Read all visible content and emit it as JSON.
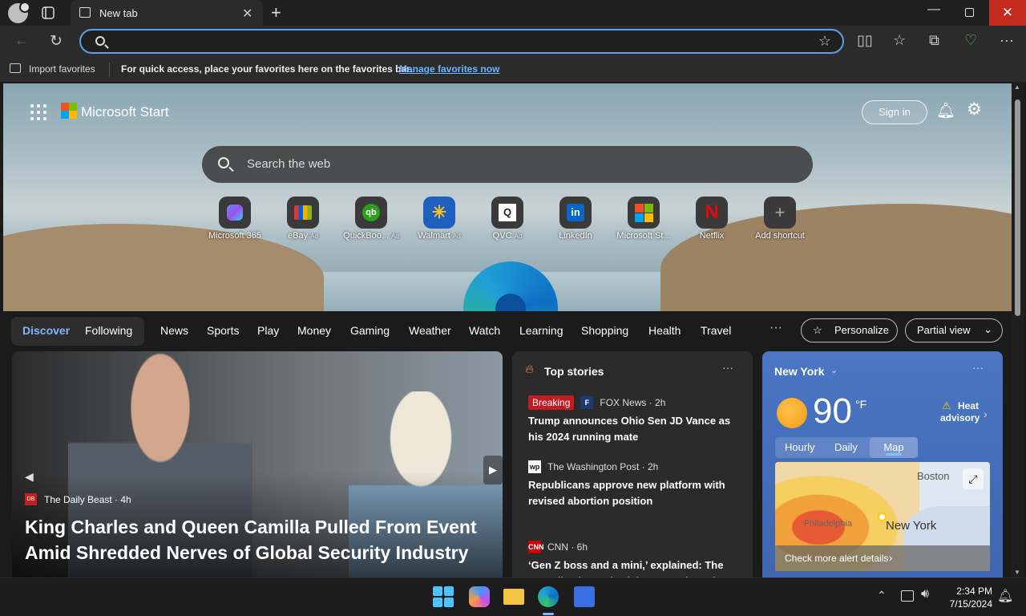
{
  "browser": {
    "tab_title": "New tab",
    "address_value": "",
    "favorites_bar": {
      "import_label": "Import favorites",
      "message": "For quick access, place your favorites here on the favorites bar.",
      "manage_link": "Manage favorites now"
    }
  },
  "start": {
    "brand": "Microsoft Start",
    "sign_in": "Sign in",
    "search_placeholder": "Search the web",
    "shortcuts": [
      {
        "label": "Microsoft 365",
        "ad": "",
        "icon": "m365-icon"
      },
      {
        "label": "eBay",
        "ad": "Ad",
        "icon": "ebay-icon"
      },
      {
        "label": "QuickBoo...",
        "ad": "Ad",
        "icon": "quickbooks-icon"
      },
      {
        "label": "Walmart",
        "ad": "Ad",
        "icon": "walmart-icon"
      },
      {
        "label": "QVC",
        "ad": "Ad",
        "icon": "qvc-icon"
      },
      {
        "label": "LinkedIn",
        "ad": "",
        "icon": "linkedin-icon"
      },
      {
        "label": "Microsoft St...",
        "ad": "",
        "icon": "microsoft-store-icon"
      },
      {
        "label": "Netflix",
        "ad": "",
        "icon": "netflix-icon"
      },
      {
        "label": "Add shortcut",
        "ad": "",
        "icon": "plus-icon"
      }
    ]
  },
  "feed_nav": {
    "discover": "Discover",
    "following": "Following",
    "links": [
      "News",
      "Sports",
      "Play",
      "Money",
      "Gaming",
      "Weather",
      "Watch",
      "Learning",
      "Shopping",
      "Health",
      "Travel"
    ],
    "more": "···",
    "personalize": "Personalize",
    "partial_view": "Partial view"
  },
  "feature": {
    "source": "The Daily Beast · 4h",
    "source_icon_text": "DB",
    "title": "King Charles and Queen Camilla Pulled From Event Amid Shredded Nerves of Global Security Industry"
  },
  "top_stories": {
    "heading": "Top stories",
    "items": [
      {
        "badge": "Breaking",
        "source": "FOX News · 2h",
        "title": "Trump announces Ohio Sen JD Vance as his 2024 running mate"
      },
      {
        "badge": "",
        "source": "The Washington Post · 2h",
        "title": "Republicans approve new platform with revised abortion position"
      },
      {
        "badge": "",
        "source": "CNN · 6h",
        "title": "‘Gen Z boss and a mini,’ explained: The new TikTok trend celebrates style and..."
      }
    ]
  },
  "weather": {
    "city": "New York",
    "temperature": "90",
    "unit": "°F",
    "alert": "Heat advisory",
    "tabs": [
      "Hourly",
      "Daily",
      "Map"
    ],
    "map_labels": {
      "boston": "Boston",
      "new_york": "New York",
      "philadelphia": "Philadelphia"
    },
    "alert_link": "Check more alert details"
  },
  "taskbar": {
    "time": "2:34 PM",
    "date": "7/15/2024"
  },
  "colors": {
    "accent": "#5aa0e6",
    "close_red": "#c42b1c",
    "breaking_red": "#c11c24",
    "weather_blue": "#4a76c3"
  }
}
